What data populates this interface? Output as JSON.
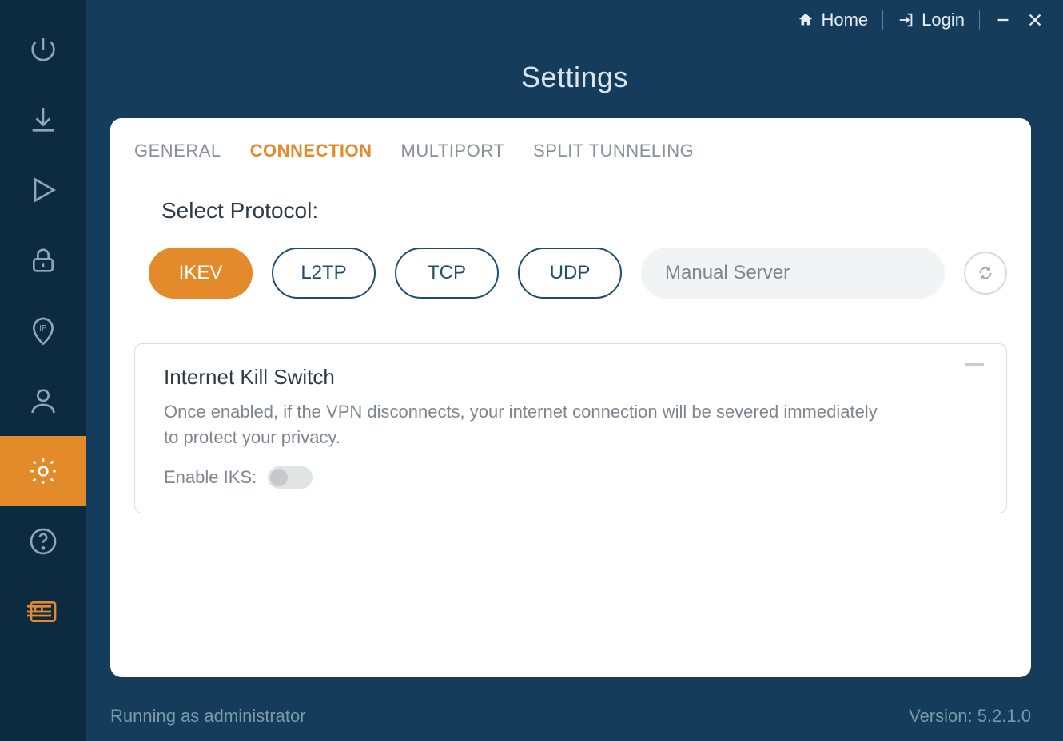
{
  "topbar": {
    "home": "Home",
    "login": "Login"
  },
  "page_title": "Settings",
  "tabs": {
    "general": "GENERAL",
    "connection": "CONNECTION",
    "multiport": "MULTIPORT",
    "split_tunneling": "SPLIT TUNNELING"
  },
  "protocol": {
    "label": "Select Protocol:",
    "options": {
      "ikev": "IKEV",
      "l2tp": "L2TP",
      "tcp": "TCP",
      "udp": "UDP"
    },
    "manual_server_placeholder": "Manual Server"
  },
  "kill_switch": {
    "title": "Internet Kill Switch",
    "description": "Once enabled, if the VPN disconnects, your internet connection will be severed immediately to protect your privacy.",
    "enable_label": "Enable IKS:"
  },
  "footer": {
    "admin": "Running as administrator",
    "version": "Version: 5.2.1.0"
  }
}
